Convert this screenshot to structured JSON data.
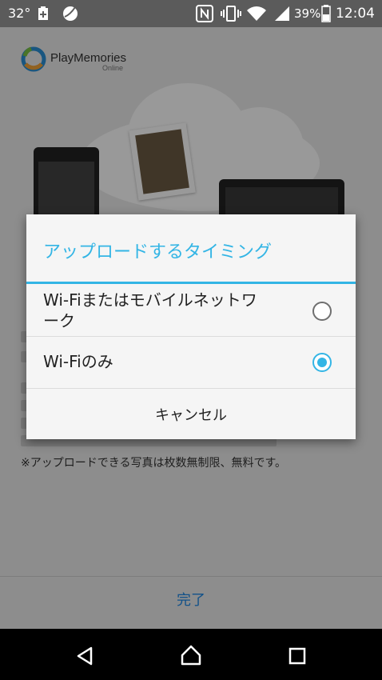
{
  "status_bar": {
    "temperature": "32°",
    "battery_percent": "39%",
    "time": "12:04",
    "icons": [
      "battery-plus-icon",
      "globe-icon",
      "nfc-icon",
      "vibrate-icon",
      "wifi-icon",
      "signal-icon",
      "battery-icon"
    ]
  },
  "app": {
    "logo_name": "PlayMemories",
    "logo_sub": "Online",
    "footnote": "※アップロードできる写真は枚数無制限、無料です。",
    "done_label": "完了"
  },
  "dialog": {
    "title": "アップロードするタイミング",
    "options": [
      {
        "label_line1": "Wi-Fiまたはモバイルネットワ",
        "label_line2": "ーク",
        "selected": false
      },
      {
        "label_line1": "Wi-Fiのみ",
        "selected": true
      }
    ],
    "cancel_label": "キャンセル"
  },
  "nav_bar": {
    "icons": [
      "back-icon",
      "home-icon",
      "recents-icon"
    ]
  },
  "colors": {
    "accent": "#33b5e5",
    "done_text": "#1e88e5"
  }
}
